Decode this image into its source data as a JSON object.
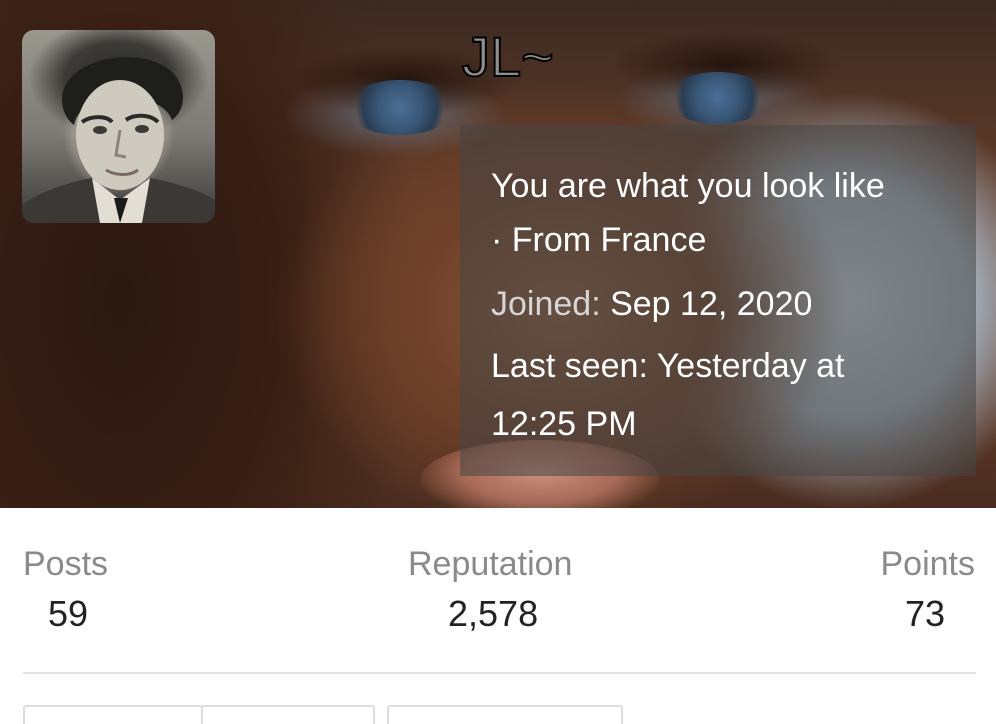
{
  "profile": {
    "username": "JL~",
    "tagline": "You are what you look like",
    "location": "· From France",
    "joined_label": "Joined:",
    "joined_value": "Sep 12, 2020",
    "last_seen_label": "Last seen:",
    "last_seen_value": "Yesterday at 12:25 PM"
  },
  "stats": {
    "posts_label": "Posts",
    "posts_value": "59",
    "reputation_label": "Reputation",
    "reputation_value": "2,578",
    "points_label": "Points",
    "points_value": "73"
  },
  "colors": {
    "overlay": "#464646",
    "muted_text": "#8a8a8a",
    "value_text": "#222222"
  }
}
